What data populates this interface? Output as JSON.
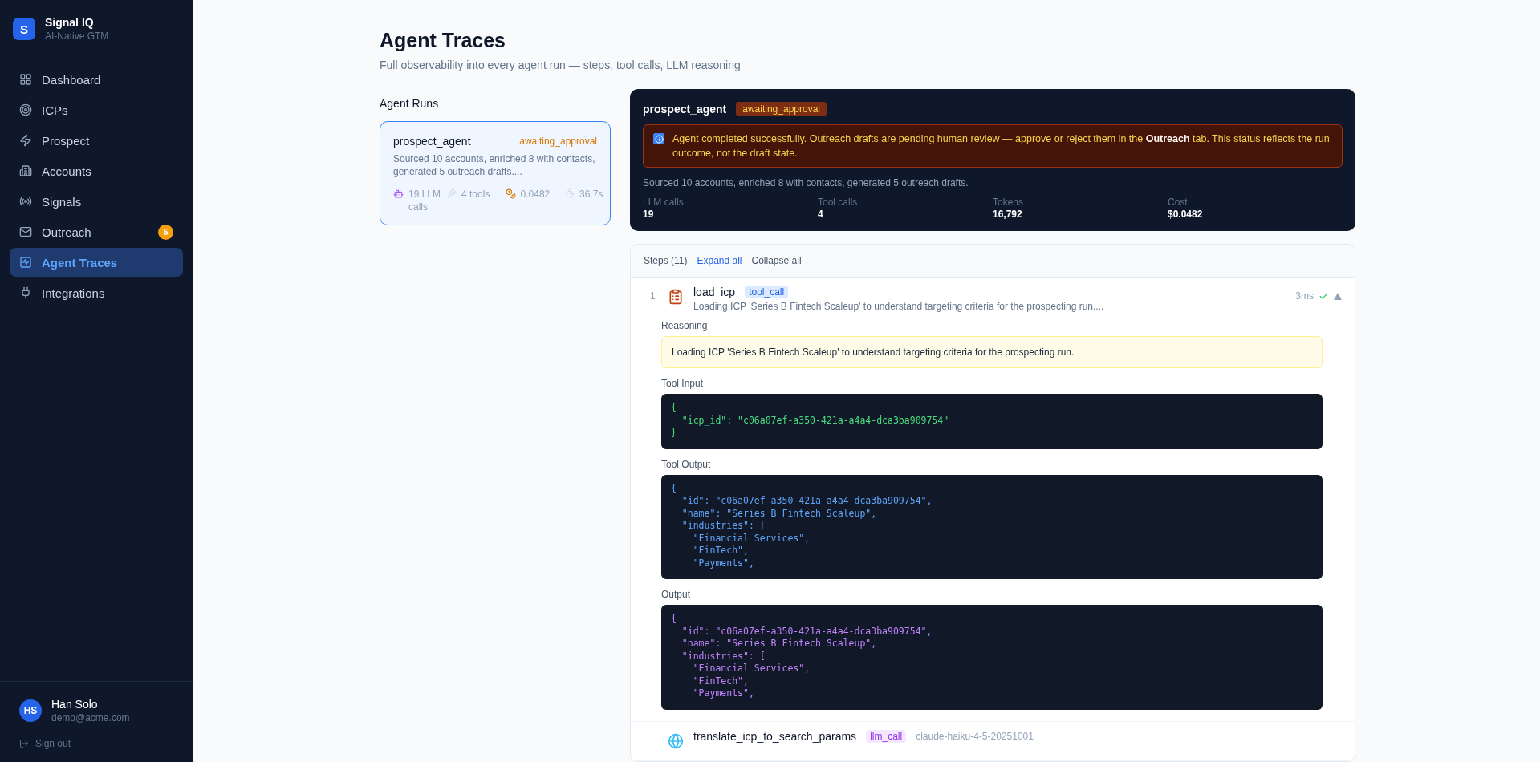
{
  "brand": {
    "logo_letter": "S",
    "name": "Signal IQ",
    "tagline": "AI-Native GTM"
  },
  "sidebar": {
    "items": [
      {
        "label": "Dashboard",
        "selected": false
      },
      {
        "label": "ICPs",
        "selected": false
      },
      {
        "label": "Prospect",
        "selected": false
      },
      {
        "label": "Accounts",
        "selected": false
      },
      {
        "label": "Signals",
        "selected": false
      },
      {
        "label": "Outreach",
        "selected": false,
        "badge": "5"
      },
      {
        "label": "Agent Traces",
        "selected": true
      },
      {
        "label": "Integrations",
        "selected": false
      }
    ]
  },
  "user": {
    "initials": "HS",
    "name": "Han Solo",
    "email": "demo@acme.com",
    "sign_out": "Sign out"
  },
  "page": {
    "title": "Agent Traces",
    "subtitle": "Full observability into every agent run — steps, tool calls, LLM reasoning"
  },
  "runs": {
    "heading": "Agent Runs",
    "items": [
      {
        "name": "prospect_agent",
        "status": "awaiting_approval",
        "summary": "Sourced 10 accounts, enriched 8 with contacts, generated 5 outreach drafts....",
        "selected": true,
        "llm_calls": "19 LLM calls",
        "tools": "4 tools",
        "cost": "0.0482",
        "duration": "36.7s"
      }
    ]
  },
  "run_detail": {
    "name": "prospect_agent",
    "status": "awaiting_approval",
    "notice": "Agent completed successfully. Outreach drafts are pending human review — approve or reject them in the **Outreach** tab. This status reflects the run outcome, not the draft state.",
    "summary": "Sourced 10 accounts, enriched 8 with contacts, generated 5 outreach drafts.",
    "stats": [
      {
        "label": "LLM calls",
        "value": "19"
      },
      {
        "label": "Tool calls",
        "value": "4"
      },
      {
        "label": "Tokens",
        "value": "16,792"
      },
      {
        "label": "Cost",
        "value": "$0.0482"
      }
    ]
  },
  "steps": {
    "count_label": "Steps (11)",
    "expand_all": "Expand all",
    "collapse_all": "Collapse all",
    "items": [
      {
        "number": "1",
        "kind": "tool_call",
        "name": "load_icp",
        "type_tag": "tool_call",
        "summary": "Loading ICP 'Series B Fintech Scaleup' to understand targeting criteria for the prospecting run....",
        "duration": "3ms",
        "success": true,
        "expanded": true,
        "sections": [
          {
            "kind": "reasoning",
            "label": "Reasoning",
            "text": "Loading ICP 'Series B Fintech Scaleup' to understand targeting criteria for the prospecting run."
          },
          {
            "kind": "tool_input",
            "label": "Tool Input",
            "lines": [
              "{",
              "  \"icp_id\": \"c06a07ef-a350-421a-a4a4-dca3ba909754\"",
              "}"
            ]
          },
          {
            "kind": "tool_output",
            "label": "Tool Output",
            "lines": [
              "{",
              "  \"id\": \"c06a07ef-a350-421a-a4a4-dca3ba909754\",",
              "  \"name\": \"Series B Fintech Scaleup\",",
              "  \"industries\": [",
              "    \"Financial Services\",",
              "    \"FinTech\",",
              "    \"Payments\","
            ]
          },
          {
            "kind": "output",
            "label": "Output",
            "lines": [
              "{",
              "  \"id\": \"c06a07ef-a350-421a-a4a4-dca3ba909754\",",
              "  \"name\": \"Series B Fintech Scaleup\",",
              "  \"industries\": [",
              "    \"Financial Services\",",
              "    \"FinTech\",",
              "    \"Payments\","
            ]
          }
        ]
      },
      {
        "kind": "llm_call",
        "name": "translate_icp_to_search_params",
        "type_tag": "llm_call",
        "model": "claude-haiku-4-5-20251001"
      }
    ]
  }
}
